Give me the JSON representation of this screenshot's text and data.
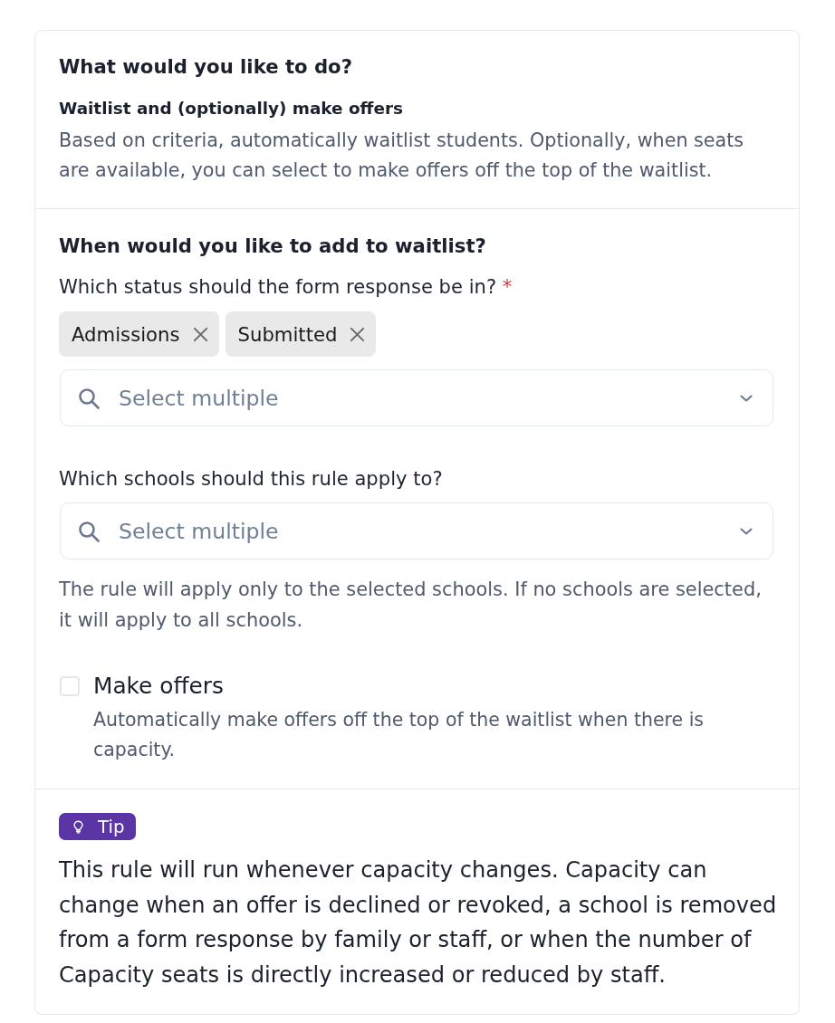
{
  "intro": {
    "title": "What would you like to do?",
    "option_title": "Waitlist and (optionally) make offers",
    "option_description": "Based on criteria, automatically waitlist students. Optionally, when seats are available, you can select to make offers off the top of the waitlist."
  },
  "waitlist_section": {
    "title": "When would you like to add to waitlist?",
    "fields": [
      {
        "kind": "multiselect",
        "label": "Which status should the form response be in?",
        "required_mark": "*",
        "chips": [
          {
            "label": "Admissions"
          },
          {
            "label": "Submitted"
          }
        ],
        "placeholder": "Select multiple"
      },
      {
        "kind": "multiselect",
        "label": "Which schools should this rule apply to?",
        "placeholder": "Select multiple",
        "help": "The rule will apply only to the selected schools. If no schools are selected, it will apply to all schools."
      }
    ],
    "option": {
      "kind": "checkbox",
      "label": "Make offers",
      "checked": false,
      "description": "Automatically make offers off the top of the waitlist when there is capacity."
    }
  },
  "tip": {
    "badge": "Tip",
    "text": "This rule will run whenever capacity changes. Capacity can change when an offer is declined or revoked, a school is removed from a form response by family or staff, or when the number of Capacity seats is directly increased or reduced by staff."
  }
}
